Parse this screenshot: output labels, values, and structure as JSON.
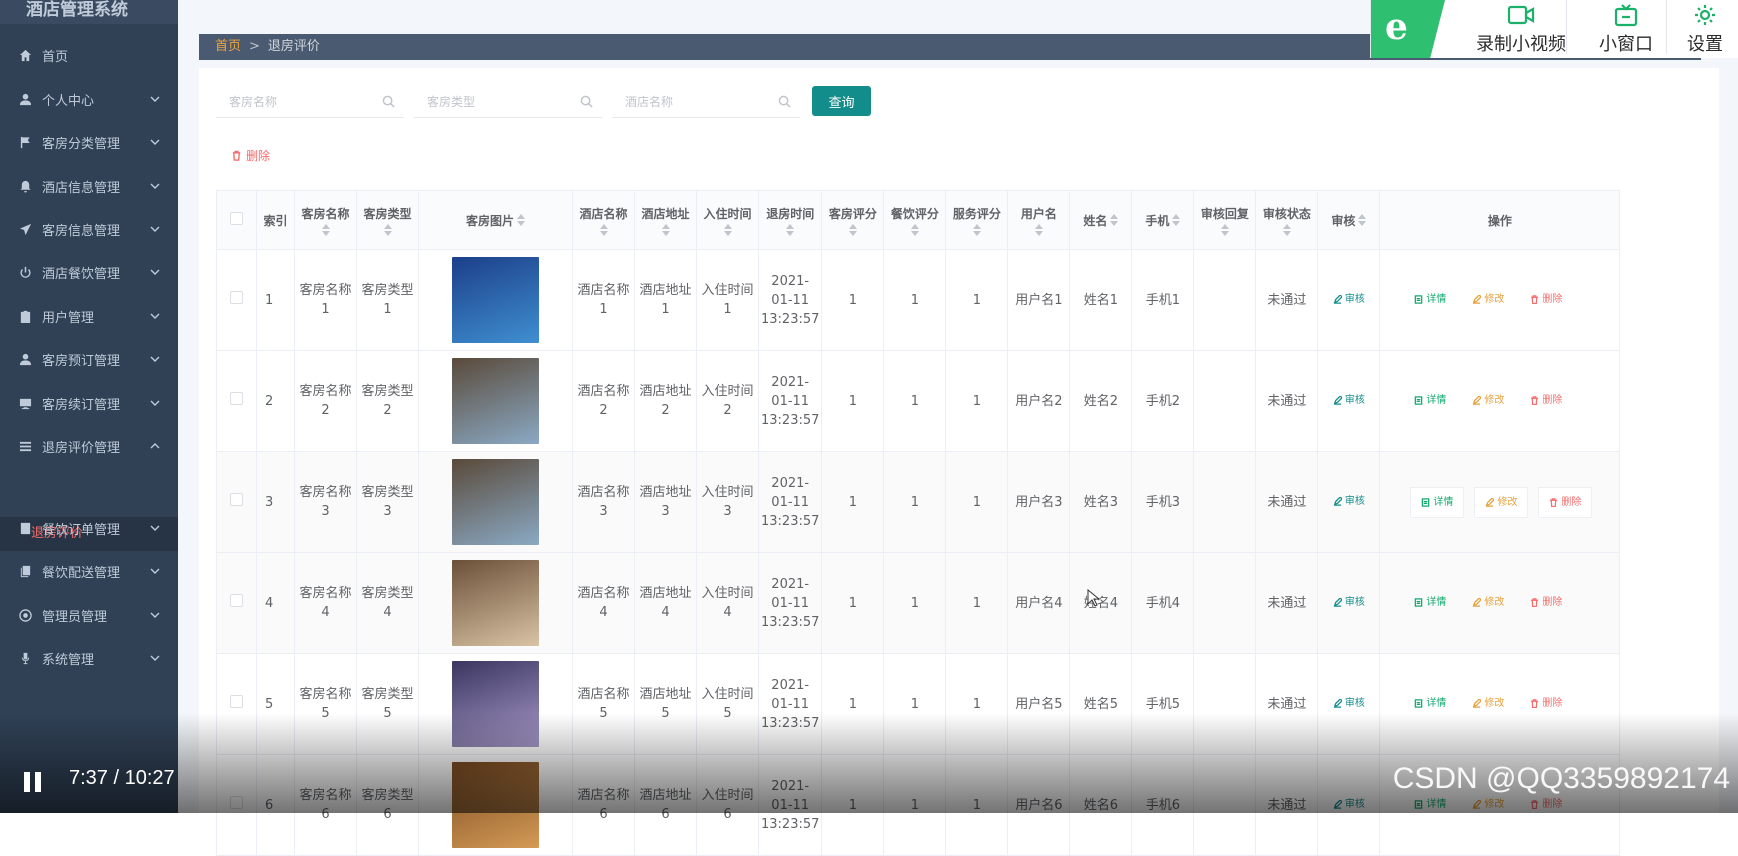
{
  "app": {
    "title": "酒店管理系统"
  },
  "sidebar": {
    "items": [
      {
        "label": "首页",
        "icon": "home-icon",
        "has_children": false
      },
      {
        "label": "个人中心",
        "icon": "user-icon",
        "has_children": true
      },
      {
        "label": "客房分类管理",
        "icon": "flag-icon",
        "has_children": true
      },
      {
        "label": "酒店信息管理",
        "icon": "bell-off-icon",
        "has_children": true
      },
      {
        "label": "客房信息管理",
        "icon": "send-icon",
        "has_children": true
      },
      {
        "label": "酒店餐饮管理",
        "icon": "power-icon",
        "has_children": true
      },
      {
        "label": "用户管理",
        "icon": "clipboard-icon",
        "has_children": true
      },
      {
        "label": "客房预订管理",
        "icon": "user-icon",
        "has_children": true
      },
      {
        "label": "客房续订管理",
        "icon": "monitor-icon",
        "has_children": true
      },
      {
        "label": "退房评价管理",
        "icon": "menu-icon",
        "has_children": true,
        "expanded": true
      },
      {
        "label": "餐饮订单管理",
        "icon": "book-icon",
        "has_children": true
      },
      {
        "label": "餐饮配送管理",
        "icon": "copy-icon",
        "has_children": true
      },
      {
        "label": "管理员管理",
        "icon": "globe-icon",
        "has_children": true
      },
      {
        "label": "系统管理",
        "icon": "mic-icon",
        "has_children": true
      }
    ],
    "active_sub": "退房评价"
  },
  "breadcrumb": {
    "home": "首页",
    "separator": ">",
    "current": "退房评价"
  },
  "search": {
    "room_name_placeholder": "客房名称",
    "room_type_placeholder": "客房类型",
    "hotel_name_placeholder": "酒店名称",
    "query_label": "查询"
  },
  "toolbar": {
    "delete_label": "删除"
  },
  "table": {
    "headers": {
      "index": "索引",
      "room_name": "客房名称",
      "room_type": "客房类型",
      "room_image": "客房图片",
      "hotel_name": "酒店名称",
      "hotel_address": "酒店地址",
      "checkin_time": "入住时间",
      "checkout_time": "退房时间",
      "room_rating": "客房评分",
      "dining_rating": "餐饮评分",
      "service_rating": "服务评分",
      "username": "用户名",
      "name": "姓名",
      "phone": "手机",
      "review_reply": "审核回复",
      "review_status": "审核状态",
      "review": "审核",
      "actions": "操作"
    },
    "action_labels": {
      "review": "审核",
      "detail": "详情",
      "edit": "修改",
      "delete": "删除"
    },
    "rows": [
      {
        "index": "1",
        "room_name": "客房名称1",
        "room_type": "客房类型1",
        "image_colors": [
          "#1c3f8a",
          "#3f8fd0"
        ],
        "hotel_name": "酒店名称1",
        "hotel_address": "酒店地址1",
        "checkin_time": "入住时间1",
        "checkout_time": "2021-01-11 13:23:57",
        "room_rating": "1",
        "dining_rating": "1",
        "service_rating": "1",
        "username": "用户名1",
        "name": "姓名1",
        "phone": "手机1",
        "review_reply": "",
        "review_status": "未通过"
      },
      {
        "index": "2",
        "room_name": "客房名称2",
        "room_type": "客房类型2",
        "image_colors": [
          "#5a4a3a",
          "#8aa9c4"
        ],
        "hotel_name": "酒店名称2",
        "hotel_address": "酒店地址2",
        "checkin_time": "入住时间2",
        "checkout_time": "2021-01-11 13:23:57",
        "room_rating": "1",
        "dining_rating": "1",
        "service_rating": "1",
        "username": "用户名2",
        "name": "姓名2",
        "phone": "手机2",
        "review_reply": "",
        "review_status": "未通过"
      },
      {
        "index": "3",
        "room_name": "客房名称3",
        "room_type": "客房类型3",
        "image_colors": [
          "#5a4a3a",
          "#8aa9c4"
        ],
        "hotel_name": "酒店名称3",
        "hotel_address": "酒店地址3",
        "checkin_time": "入住时间3",
        "checkout_time": "2021-01-11 13:23:57",
        "room_rating": "1",
        "dining_rating": "1",
        "service_rating": "1",
        "username": "用户名3",
        "name": "姓名3",
        "phone": "手机3",
        "review_reply": "",
        "review_status": "未通过"
      },
      {
        "index": "4",
        "room_name": "客房名称4",
        "room_type": "客房类型4",
        "image_colors": [
          "#6b5038",
          "#d9c3a5"
        ],
        "hotel_name": "酒店名称4",
        "hotel_address": "酒店地址4",
        "checkin_time": "入住时间4",
        "checkout_time": "2021-01-11 13:23:57",
        "room_rating": "1",
        "dining_rating": "1",
        "service_rating": "1",
        "username": "用户名4",
        "name": "姓名4",
        "phone": "手机4",
        "review_reply": "",
        "review_status": "未通过"
      },
      {
        "index": "5",
        "room_name": "客房名称5",
        "room_type": "客房类型5",
        "image_colors": [
          "#3b3560",
          "#a79ac9"
        ],
        "hotel_name": "酒店名称5",
        "hotel_address": "酒店地址5",
        "checkin_time": "入住时间5",
        "checkout_time": "2021-01-11 13:23:57",
        "room_rating": "1",
        "dining_rating": "1",
        "service_rating": "1",
        "username": "用户名5",
        "name": "姓名5",
        "phone": "手机5",
        "review_reply": "",
        "review_status": "未通过"
      },
      {
        "index": "6",
        "room_name": "客房名称6",
        "room_type": "客房类型6",
        "image_colors": [
          "#7a4a22",
          "#d49a55"
        ],
        "hotel_name": "酒店名称6",
        "hotel_address": "酒店地址6",
        "checkin_time": "入住时间6",
        "checkout_time": "2021-01-11 13:23:57",
        "room_rating": "1",
        "dining_rating": "1",
        "service_rating": "1",
        "username": "用户名6",
        "name": "姓名6",
        "phone": "手机6",
        "review_reply": "",
        "review_status": "未通过"
      }
    ]
  },
  "recorder": {
    "record_label": "录制小视频",
    "mini_window_label": "小窗口",
    "settings_label": "设置",
    "brand_glyph": "e"
  },
  "video": {
    "time": "7:37 / 10:27",
    "watermark": "CSDN @QQ3359892174"
  },
  "colors": {
    "sidebar_bg": "#304156",
    "accent_teal": "#138d8b",
    "danger": "#f56c6c",
    "warning": "#e6a23c",
    "success": "#13a96e",
    "recorder_green": "#2fbf71"
  }
}
